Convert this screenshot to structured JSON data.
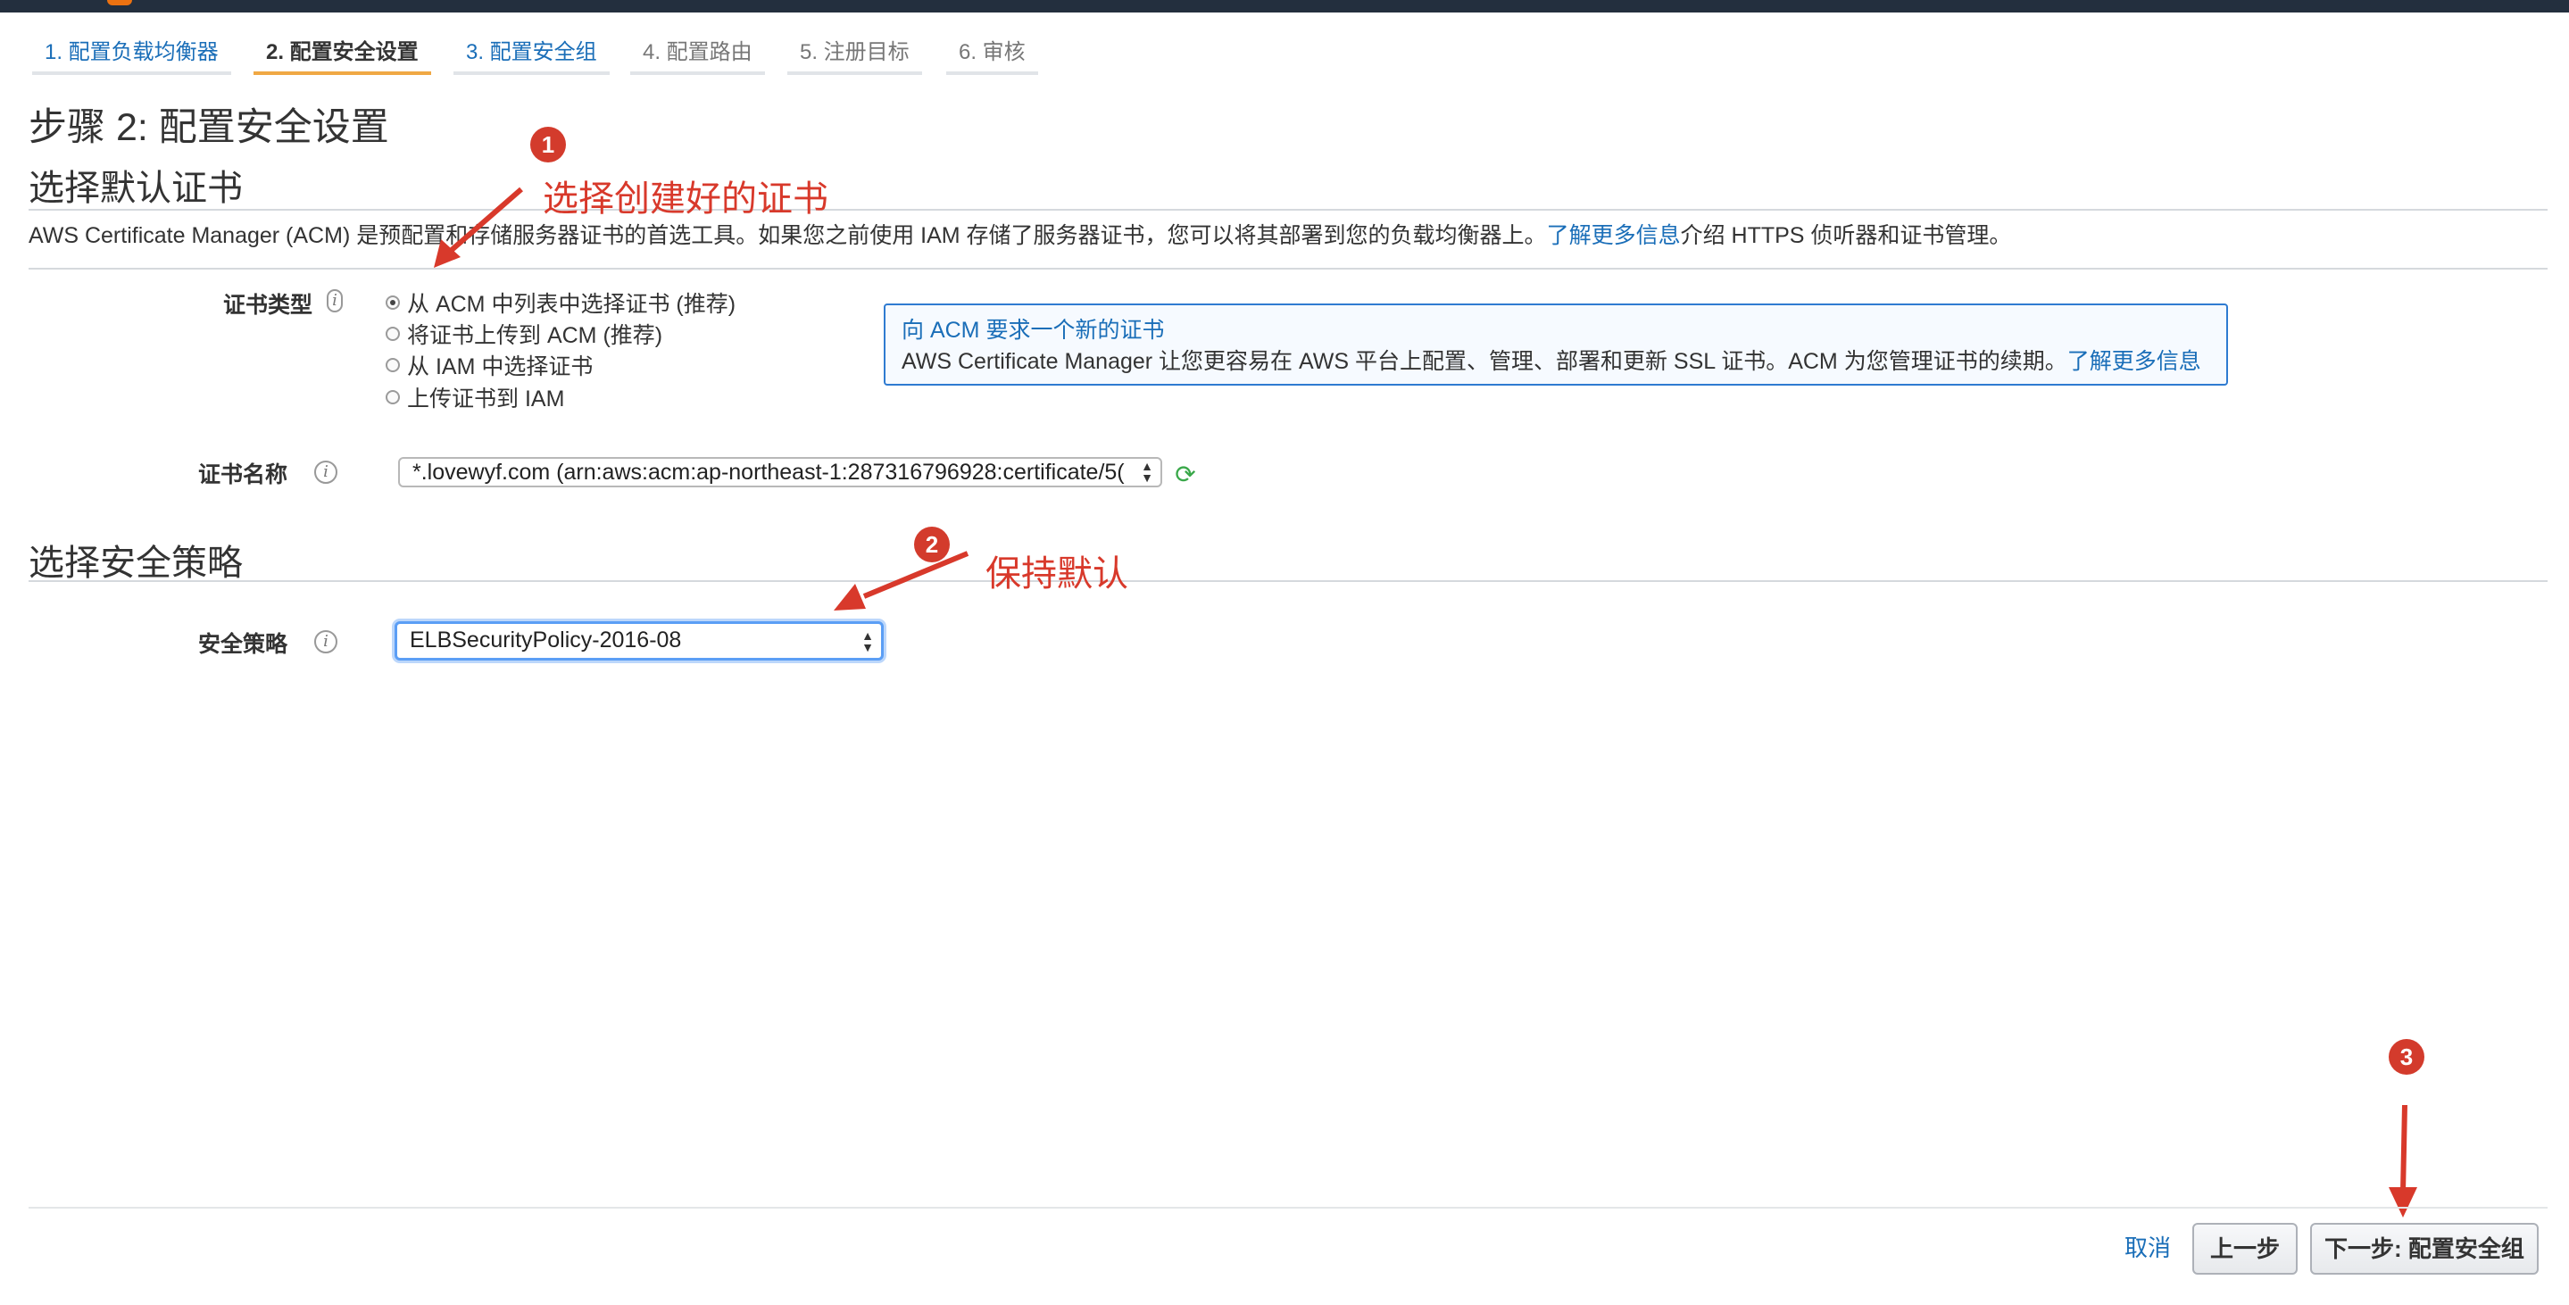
{
  "tabs": [
    {
      "label": "1. 配置负载均衡器"
    },
    {
      "label": "2. 配置安全设置"
    },
    {
      "label": "3. 配置安全组"
    },
    {
      "label": "4. 配置路由"
    },
    {
      "label": "5. 注册目标"
    },
    {
      "label": "6. 审核"
    }
  ],
  "active_tab_index": 1,
  "page_title": "步骤 2: 配置安全设置",
  "cert_section": {
    "heading": "选择默认证书",
    "desc_text": "AWS Certificate Manager (ACM) 是预配置和存储服务器证书的首选工具。如果您之前使用 IAM 存储了服务器证书，您可以将其部署到您的负载均衡器上。",
    "desc_link": "了解更多信息",
    "desc_suffix": "介绍 HTTPS 侦听器和证书管理。",
    "cert_type_label": "证书类型",
    "cert_type_options": [
      {
        "label": "从 ACM 中列表中选择证书 (推荐)",
        "checked": true
      },
      {
        "label": "将证书上传到 ACM (推荐)",
        "checked": false
      },
      {
        "label": "从 IAM 中选择证书",
        "checked": false
      },
      {
        "label": "上传证书到 IAM",
        "checked": false
      }
    ],
    "acm_box": {
      "title": "向 ACM 要求一个新的证书",
      "body": "AWS Certificate Manager 让您更容易在 AWS 平台上配置、管理、部署和更新 SSL 证书。ACM 为您管理证书的续期。",
      "link": "了解更多信息"
    },
    "cert_name_label": "证书名称",
    "cert_name_value": "*.lovewyf.com (arn:aws:acm:ap-northeast-1:287316796928:certificate/5("
  },
  "policy_section": {
    "heading": "选择安全策略",
    "policy_label": "安全策略",
    "policy_value": "ELBSecurityPolicy-2016-08"
  },
  "annotations": [
    {
      "badge": "1",
      "text": "选择创建好的证书"
    },
    {
      "badge": "2",
      "text": "保持默认"
    },
    {
      "badge": "3",
      "text": ""
    }
  ],
  "annotation_color": "#d8392b",
  "footer": {
    "cancel": "取消",
    "prev": "上一步",
    "next": "下一步: 配置安全组"
  }
}
